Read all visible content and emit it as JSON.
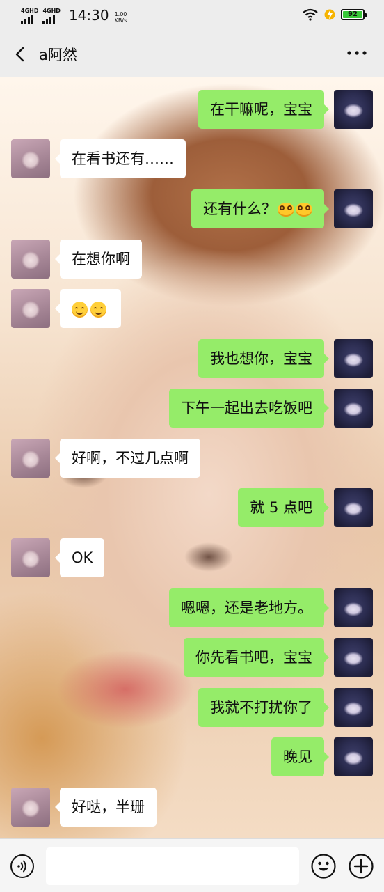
{
  "status": {
    "net1": "4GHD",
    "net2": "4GHD",
    "time": "14:30",
    "speed_value": "1.00",
    "speed_unit": "KB/s",
    "battery": "92"
  },
  "header": {
    "title": "a阿然"
  },
  "messages": [
    {
      "from": "me",
      "text": "在干嘛呢，宝宝"
    },
    {
      "from": "her",
      "text": "在看书还有……"
    },
    {
      "from": "me",
      "text": "还有什么？"
    },
    {
      "from": "her",
      "text": "在想你啊"
    },
    {
      "from": "her",
      "text": ""
    },
    {
      "from": "me",
      "text": "我也想你，宝宝"
    },
    {
      "from": "me",
      "text": "下午一起出去吃饭吧"
    },
    {
      "from": "her",
      "text": "好啊，不过几点啊"
    },
    {
      "from": "me",
      "text": "就 5 点吧"
    },
    {
      "from": "her",
      "text": "OK"
    },
    {
      "from": "me",
      "text": "嗯嗯，还是老地方。"
    },
    {
      "from": "me",
      "text": "你先看书吧，宝宝"
    },
    {
      "from": "me",
      "text": "我就不打扰你了"
    },
    {
      "from": "me",
      "text": "晚见"
    },
    {
      "from": "her",
      "text": "好哒，半珊"
    }
  ],
  "icons": {
    "back": "chevron-left-icon",
    "more": "more-dots-icon",
    "voice": "voice-icon",
    "emoji": "emoji-smile-icon",
    "plus": "plus-icon"
  },
  "colors": {
    "my_bubble": "#95ec69",
    "her_bubble": "#ffffff",
    "bar_bg": "#ededed"
  }
}
